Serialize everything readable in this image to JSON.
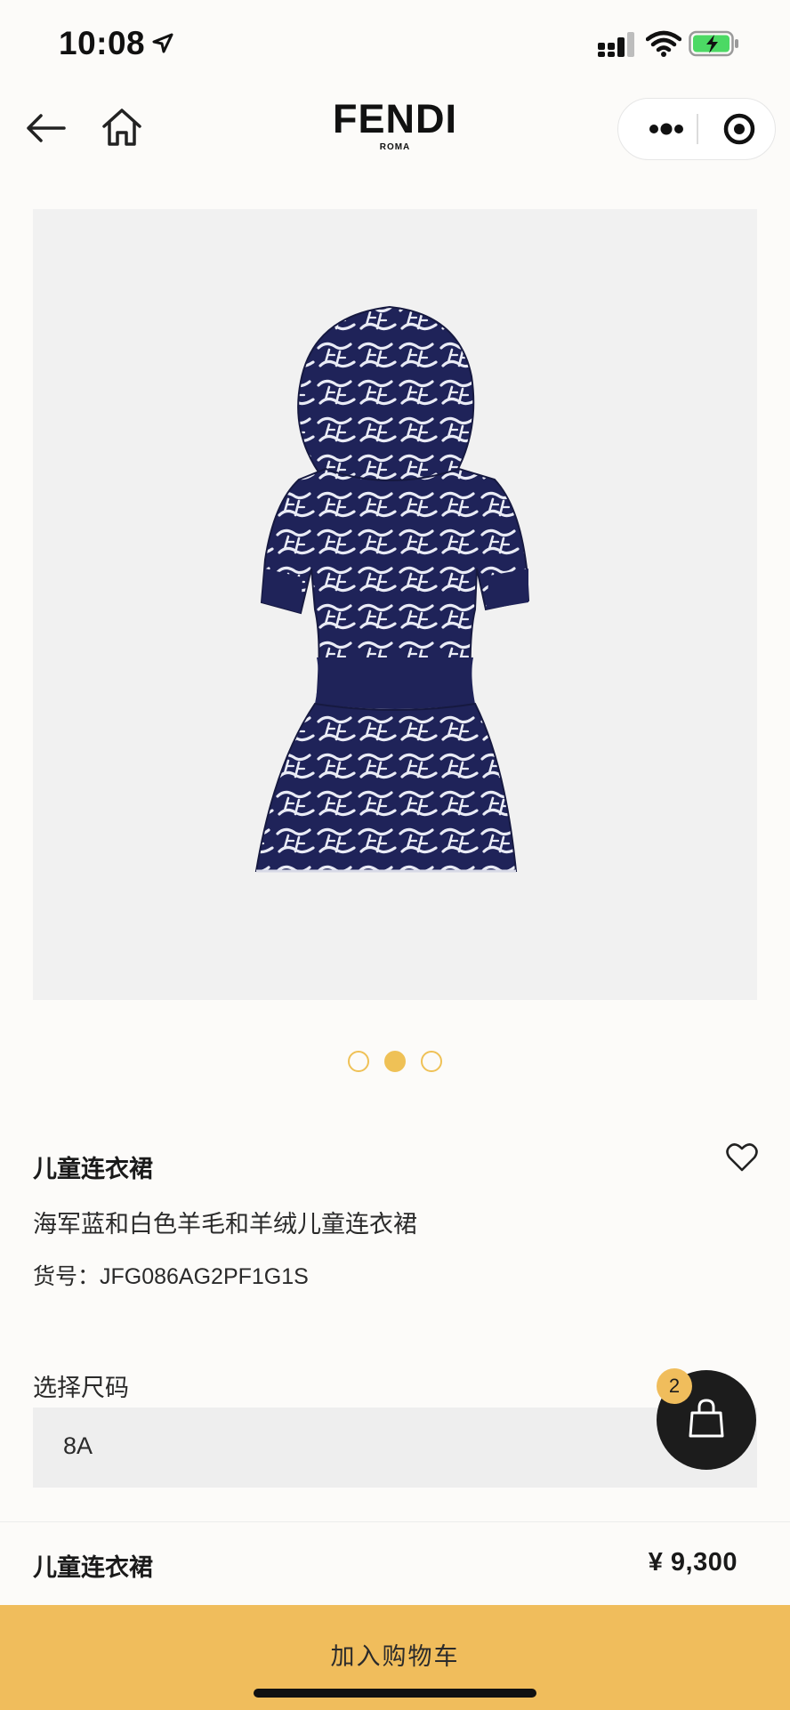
{
  "status_bar": {
    "time": "10:08",
    "icons": [
      "location-arrow-icon",
      "cellular-signal-icon",
      "wifi-icon",
      "battery-charging-icon"
    ]
  },
  "nav": {
    "brand": "FENDI",
    "brand_sub": "ROMA",
    "icons": [
      "back-arrow-icon",
      "home-icon",
      "more-dots-icon",
      "close-target-icon"
    ]
  },
  "carousel": {
    "total": 3,
    "active_index": 1
  },
  "product": {
    "name": "儿童连衣裙",
    "description": "海军蓝和白色羊毛和羊绒儿童连衣裙",
    "sku": "货号：JFG086AG2PF1G1S"
  },
  "size": {
    "label": "选择尺码",
    "selected": "8A"
  },
  "cart": {
    "count": "2",
    "icon": "shopping-bag-icon"
  },
  "summary": {
    "name": "儿童连衣裙",
    "price": "¥ 9,300"
  },
  "cta": {
    "add_to_cart": "加入购物车"
  },
  "colors": {
    "accent": "#f0bd5c",
    "dress_navy": "#1f2359",
    "background": "#fcfbf9"
  }
}
